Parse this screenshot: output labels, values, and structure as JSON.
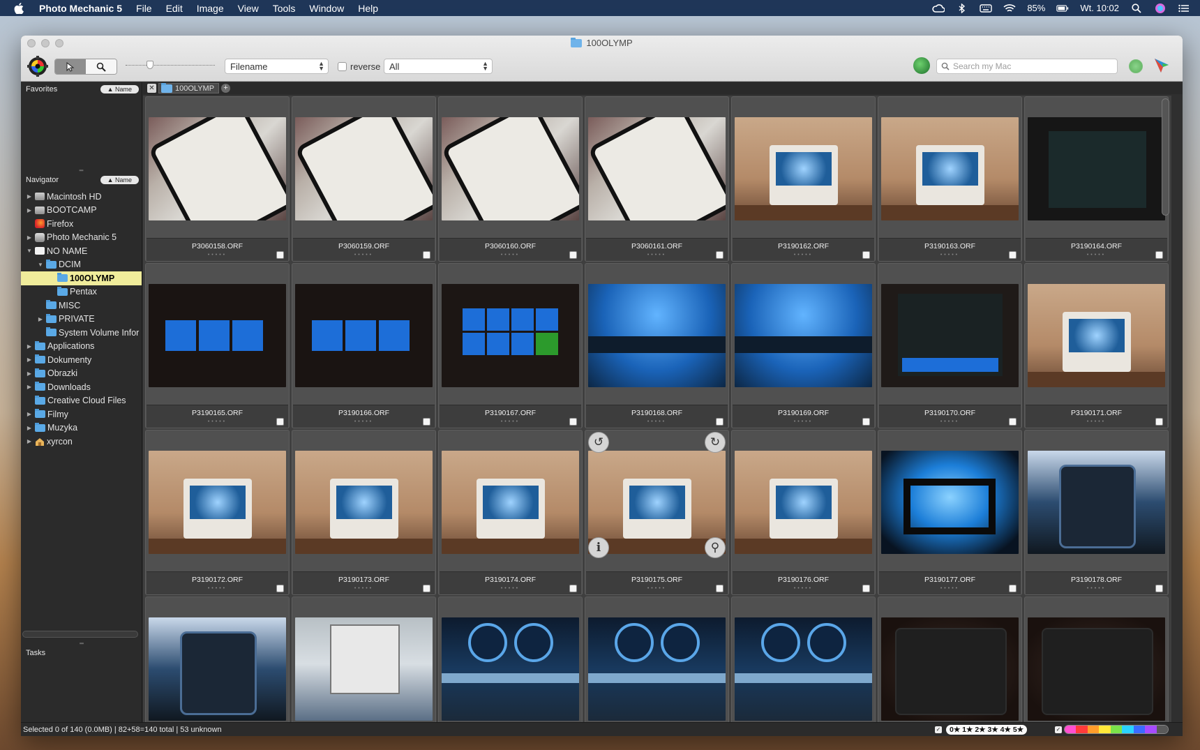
{
  "menubar": {
    "app_name": "Photo Mechanic 5",
    "items": [
      "File",
      "Edit",
      "Image",
      "View",
      "Tools",
      "Window",
      "Help"
    ],
    "battery": "85%",
    "clock": "Wt. 10:02"
  },
  "window": {
    "title": "100OLYMP"
  },
  "toolbar": {
    "sort_select": "Filename",
    "reverse_label": "reverse",
    "filter_select": "All",
    "search_placeholder": "Search my Mac"
  },
  "sidebar": {
    "favorites_title": "Favorites",
    "favorites_sort": "▲ Name",
    "navigator_title": "Navigator",
    "navigator_sort": "▲ Name",
    "tasks_title": "Tasks",
    "tree": [
      {
        "label": "Macintosh HD",
        "indent": 0,
        "tri": "▶",
        "icon": "drive"
      },
      {
        "label": "BOOTCAMP",
        "indent": 0,
        "tri": "▶",
        "icon": "drive"
      },
      {
        "label": "Firefox",
        "indent": 0,
        "tri": "",
        "icon": "app-firefox"
      },
      {
        "label": "Photo Mechanic 5",
        "indent": 0,
        "tri": "▶",
        "icon": "app-pm"
      },
      {
        "label": "NO NAME",
        "indent": 0,
        "tri": "▼",
        "icon": "drive-white"
      },
      {
        "label": "DCIM",
        "indent": 1,
        "tri": "▼",
        "icon": "folder"
      },
      {
        "label": "100OLYMP",
        "indent": 2,
        "tri": "",
        "icon": "folder",
        "selected": true
      },
      {
        "label": "Pentax",
        "indent": 2,
        "tri": "",
        "icon": "folder"
      },
      {
        "label": "MISC",
        "indent": 1,
        "tri": "",
        "icon": "folder"
      },
      {
        "label": "PRIVATE",
        "indent": 1,
        "tri": "▶",
        "icon": "folder"
      },
      {
        "label": "System Volume Infor",
        "indent": 1,
        "tri": "",
        "icon": "folder"
      },
      {
        "label": "Applications",
        "indent": 0,
        "tri": "▶",
        "icon": "folder"
      },
      {
        "label": "Dokumenty",
        "indent": 0,
        "tri": "▶",
        "icon": "folder"
      },
      {
        "label": "Obrazki",
        "indent": 0,
        "tri": "▶",
        "icon": "folder"
      },
      {
        "label": "Downloads",
        "indent": 0,
        "tri": "▶",
        "icon": "folder"
      },
      {
        "label": "Creative Cloud Files",
        "indent": 0,
        "tri": "",
        "icon": "folder"
      },
      {
        "label": "Filmy",
        "indent": 0,
        "tri": "▶",
        "icon": "folder"
      },
      {
        "label": "Muzyka",
        "indent": 0,
        "tri": "▶",
        "icon": "folder"
      },
      {
        "label": "xyrcon",
        "indent": 0,
        "tri": "▶",
        "icon": "home"
      }
    ]
  },
  "tabs": [
    {
      "label": "100OLYMP"
    }
  ],
  "photos": [
    {
      "name": "P3060158.ORF",
      "kind": "phone"
    },
    {
      "name": "P3060159.ORF",
      "kind": "phone"
    },
    {
      "name": "P3060160.ORF",
      "kind": "phone"
    },
    {
      "name": "P3060161.ORF",
      "kind": "phone"
    },
    {
      "name": "P3190162.ORF",
      "kind": "printer"
    },
    {
      "name": "P3190163.ORF",
      "kind": "printer"
    },
    {
      "name": "P3190164.ORF",
      "kind": "dark"
    },
    {
      "name": "P3190165.ORF",
      "kind": "menu"
    },
    {
      "name": "P3190166.ORF",
      "kind": "menu"
    },
    {
      "name": "P3190167.ORF",
      "kind": "menu2"
    },
    {
      "name": "P3190168.ORF",
      "kind": "blue"
    },
    {
      "name": "P3190169.ORF",
      "kind": "blue"
    },
    {
      "name": "P3190170.ORF",
      "kind": "status"
    },
    {
      "name": "P3190171.ORF",
      "kind": "printer"
    },
    {
      "name": "P3190172.ORF",
      "kind": "printer"
    },
    {
      "name": "P3190173.ORF",
      "kind": "printer"
    },
    {
      "name": "P3190174.ORF",
      "kind": "printer"
    },
    {
      "name": "P3190175.ORF",
      "kind": "printer",
      "hover": true
    },
    {
      "name": "P3190176.ORF",
      "kind": "printer"
    },
    {
      "name": "P3190177.ORF",
      "kind": "blueglow"
    },
    {
      "name": "P3190178.ORF",
      "kind": "head"
    },
    {
      "name": "",
      "kind": "head"
    },
    {
      "name": "",
      "kind": "head2"
    },
    {
      "name": "",
      "kind": "fanblue"
    },
    {
      "name": "",
      "kind": "fanblue"
    },
    {
      "name": "",
      "kind": "fanblue"
    },
    {
      "name": "",
      "kind": "case"
    },
    {
      "name": "",
      "kind": "case"
    }
  ],
  "statusbar": {
    "text": "Selected 0 of 140 (0.0MB) | 82+58=140 total | 53 unknown",
    "rating_filter": "0★ 1★ 2★ 3★ 4★ 5★",
    "color_labels": [
      "#ff4fd0",
      "#ff3b3b",
      "#ff9d2b",
      "#ffe83a",
      "#7be34a",
      "#2bd3ff",
      "#3b6bff",
      "#a74bff",
      "#5a5a5a"
    ]
  }
}
